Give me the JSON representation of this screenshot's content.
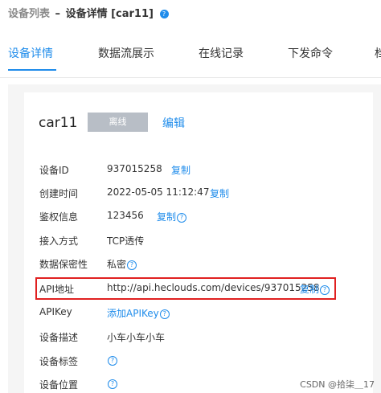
{
  "breadcrumb": {
    "list": "设备列表",
    "separator": "–",
    "current": "设备详情 [car11]",
    "help": "?"
  },
  "tabs": [
    "设备详情",
    "数据流展示",
    "在线记录",
    "下发命令",
    "档"
  ],
  "device": {
    "name": "car11",
    "status": "离线",
    "edit": "编辑"
  },
  "rows": [
    {
      "label": "设备ID",
      "value": "937015258",
      "link": "复制"
    },
    {
      "label": "创建时间",
      "value": "2022-05-05 11:12:47",
      "link": "复制"
    },
    {
      "label": "鉴权信息",
      "value": "123456",
      "link": "复制",
      "help": "?"
    },
    {
      "label": "接入方式",
      "value": "TCP透传"
    },
    {
      "label": "数据保密性",
      "value": "私密",
      "help": "?"
    },
    {
      "label": "API地址",
      "value": "http://api.heclouds.com/devices/937015258",
      "link": "复制",
      "help": "?"
    },
    {
      "label": "APIKey",
      "link": "添加APIKey",
      "help": "?"
    },
    {
      "label": "设备描述",
      "value": "小车小车小车"
    },
    {
      "label": "设备标签",
      "help": "?"
    },
    {
      "label": "设备位置",
      "help": "?"
    }
  ],
  "colors": {
    "accent": "#1f8ceb",
    "highlight": "#e02020",
    "status_bg": "#b8bec6"
  },
  "watermark": "CSDN @拾柒＿17"
}
